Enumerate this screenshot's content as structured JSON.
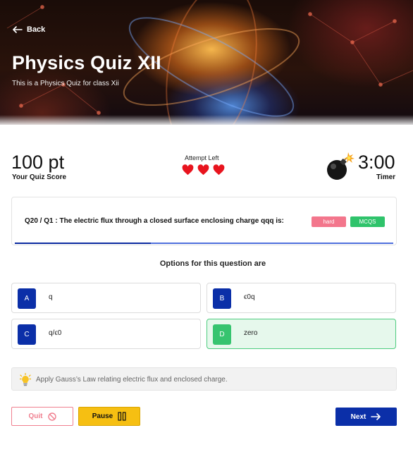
{
  "header": {
    "back_label": "Back",
    "title": "Physics Quiz XII",
    "subtitle": "This is a Physics Quiz for class Xii"
  },
  "stats": {
    "score_value": "100 pt",
    "score_label": "Your Quiz Score",
    "attempts_label": "Attempt Left",
    "attempts_remaining": 3,
    "timer_value": "3:00",
    "timer_label": "Timer"
  },
  "question": {
    "text": "Q20 / Q1 : The electric flux through a closed surface enclosing charge qqq is:",
    "difficulty_tag": "hard",
    "type_tag": "MCQS",
    "progress_fraction": 0.36
  },
  "options_title": "Options for this question are",
  "options": [
    {
      "letter": "A",
      "text": "q"
    },
    {
      "letter": "B",
      "text": "ϵ0q"
    },
    {
      "letter": "C",
      "text": "q/ϵ0"
    },
    {
      "letter": "D",
      "text": "zero",
      "selected": true
    }
  ],
  "hint": {
    "icon": "lightbulb-icon",
    "text": "Apply Gauss’s Law relating electric flux and enclosed charge."
  },
  "buttons": {
    "quit_label": "Quit",
    "pause_label": "Pause",
    "next_label": "Next"
  },
  "colors": {
    "primary": "#0b2fa8",
    "selected_bg": "#e6f8ec",
    "selected_border": "#4dcc7e",
    "hard_tag": "#f3768c",
    "mcqs_tag": "#2fc36b",
    "pause": "#f6bf12",
    "quit": "#f07f8f",
    "heart": "#e8141e"
  }
}
